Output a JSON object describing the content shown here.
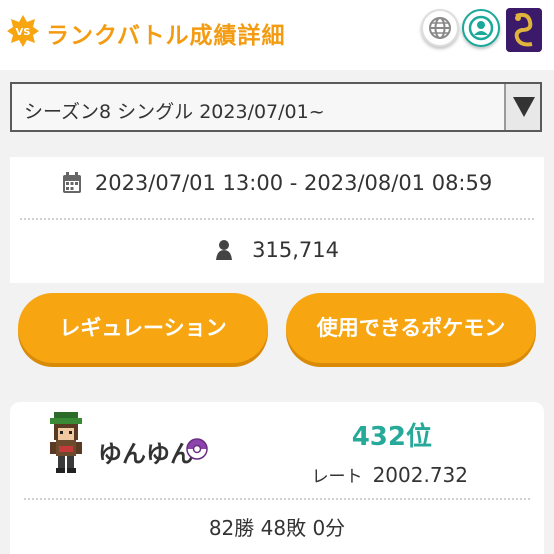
{
  "header": {
    "badge_label": "VS",
    "title": "ランクバトル成績詳細",
    "icons": [
      "globe-icon",
      "account-icon",
      "trainer-avatar"
    ]
  },
  "season": {
    "selected": "シーズン8 シングル 2023/07/01~"
  },
  "info": {
    "period": "2023/07/01 13:00 - 2023/08/01 08:59",
    "players": "315,714"
  },
  "buttons": {
    "regulation": "レギュレーション",
    "usable_pokemon": "使用できるポケモン"
  },
  "player": {
    "name": "ゆんゆん",
    "rank": "432位",
    "rate_label": "レート",
    "rate_value": "2002.732",
    "record": "82勝 48敗 0分"
  },
  "colors": {
    "accent_orange": "#f7a511",
    "rank_teal": "#27a99a",
    "ball_purple": "#8e44ad"
  }
}
